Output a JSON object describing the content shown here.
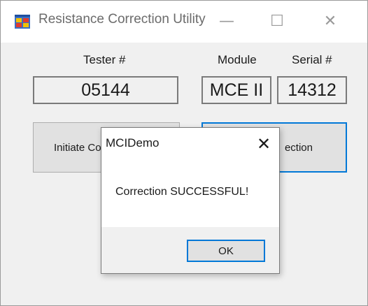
{
  "window": {
    "title": "Resistance Correction Utility",
    "controls": {
      "minimize": "—",
      "maximize": "☐",
      "close": "✕"
    }
  },
  "form": {
    "tester_label": "Tester #",
    "tester_value": "05144",
    "module_label": "Module",
    "module_value": "MCE II",
    "serial_label": "Serial #",
    "serial_value": "14312",
    "initiate_button_visible_text": "Initiate Co",
    "apply_button_visible_text": "ection"
  },
  "dialog": {
    "title": "MCIDemo",
    "close": "✕",
    "message": "Correction SUCCESSFUL!",
    "ok_label": "OK"
  },
  "colors": {
    "accent": "#0078d7",
    "window_bg": "#f0f0f0",
    "titlebar_bg": "#ffffff"
  },
  "icons": {
    "app": "app-window-icon"
  }
}
